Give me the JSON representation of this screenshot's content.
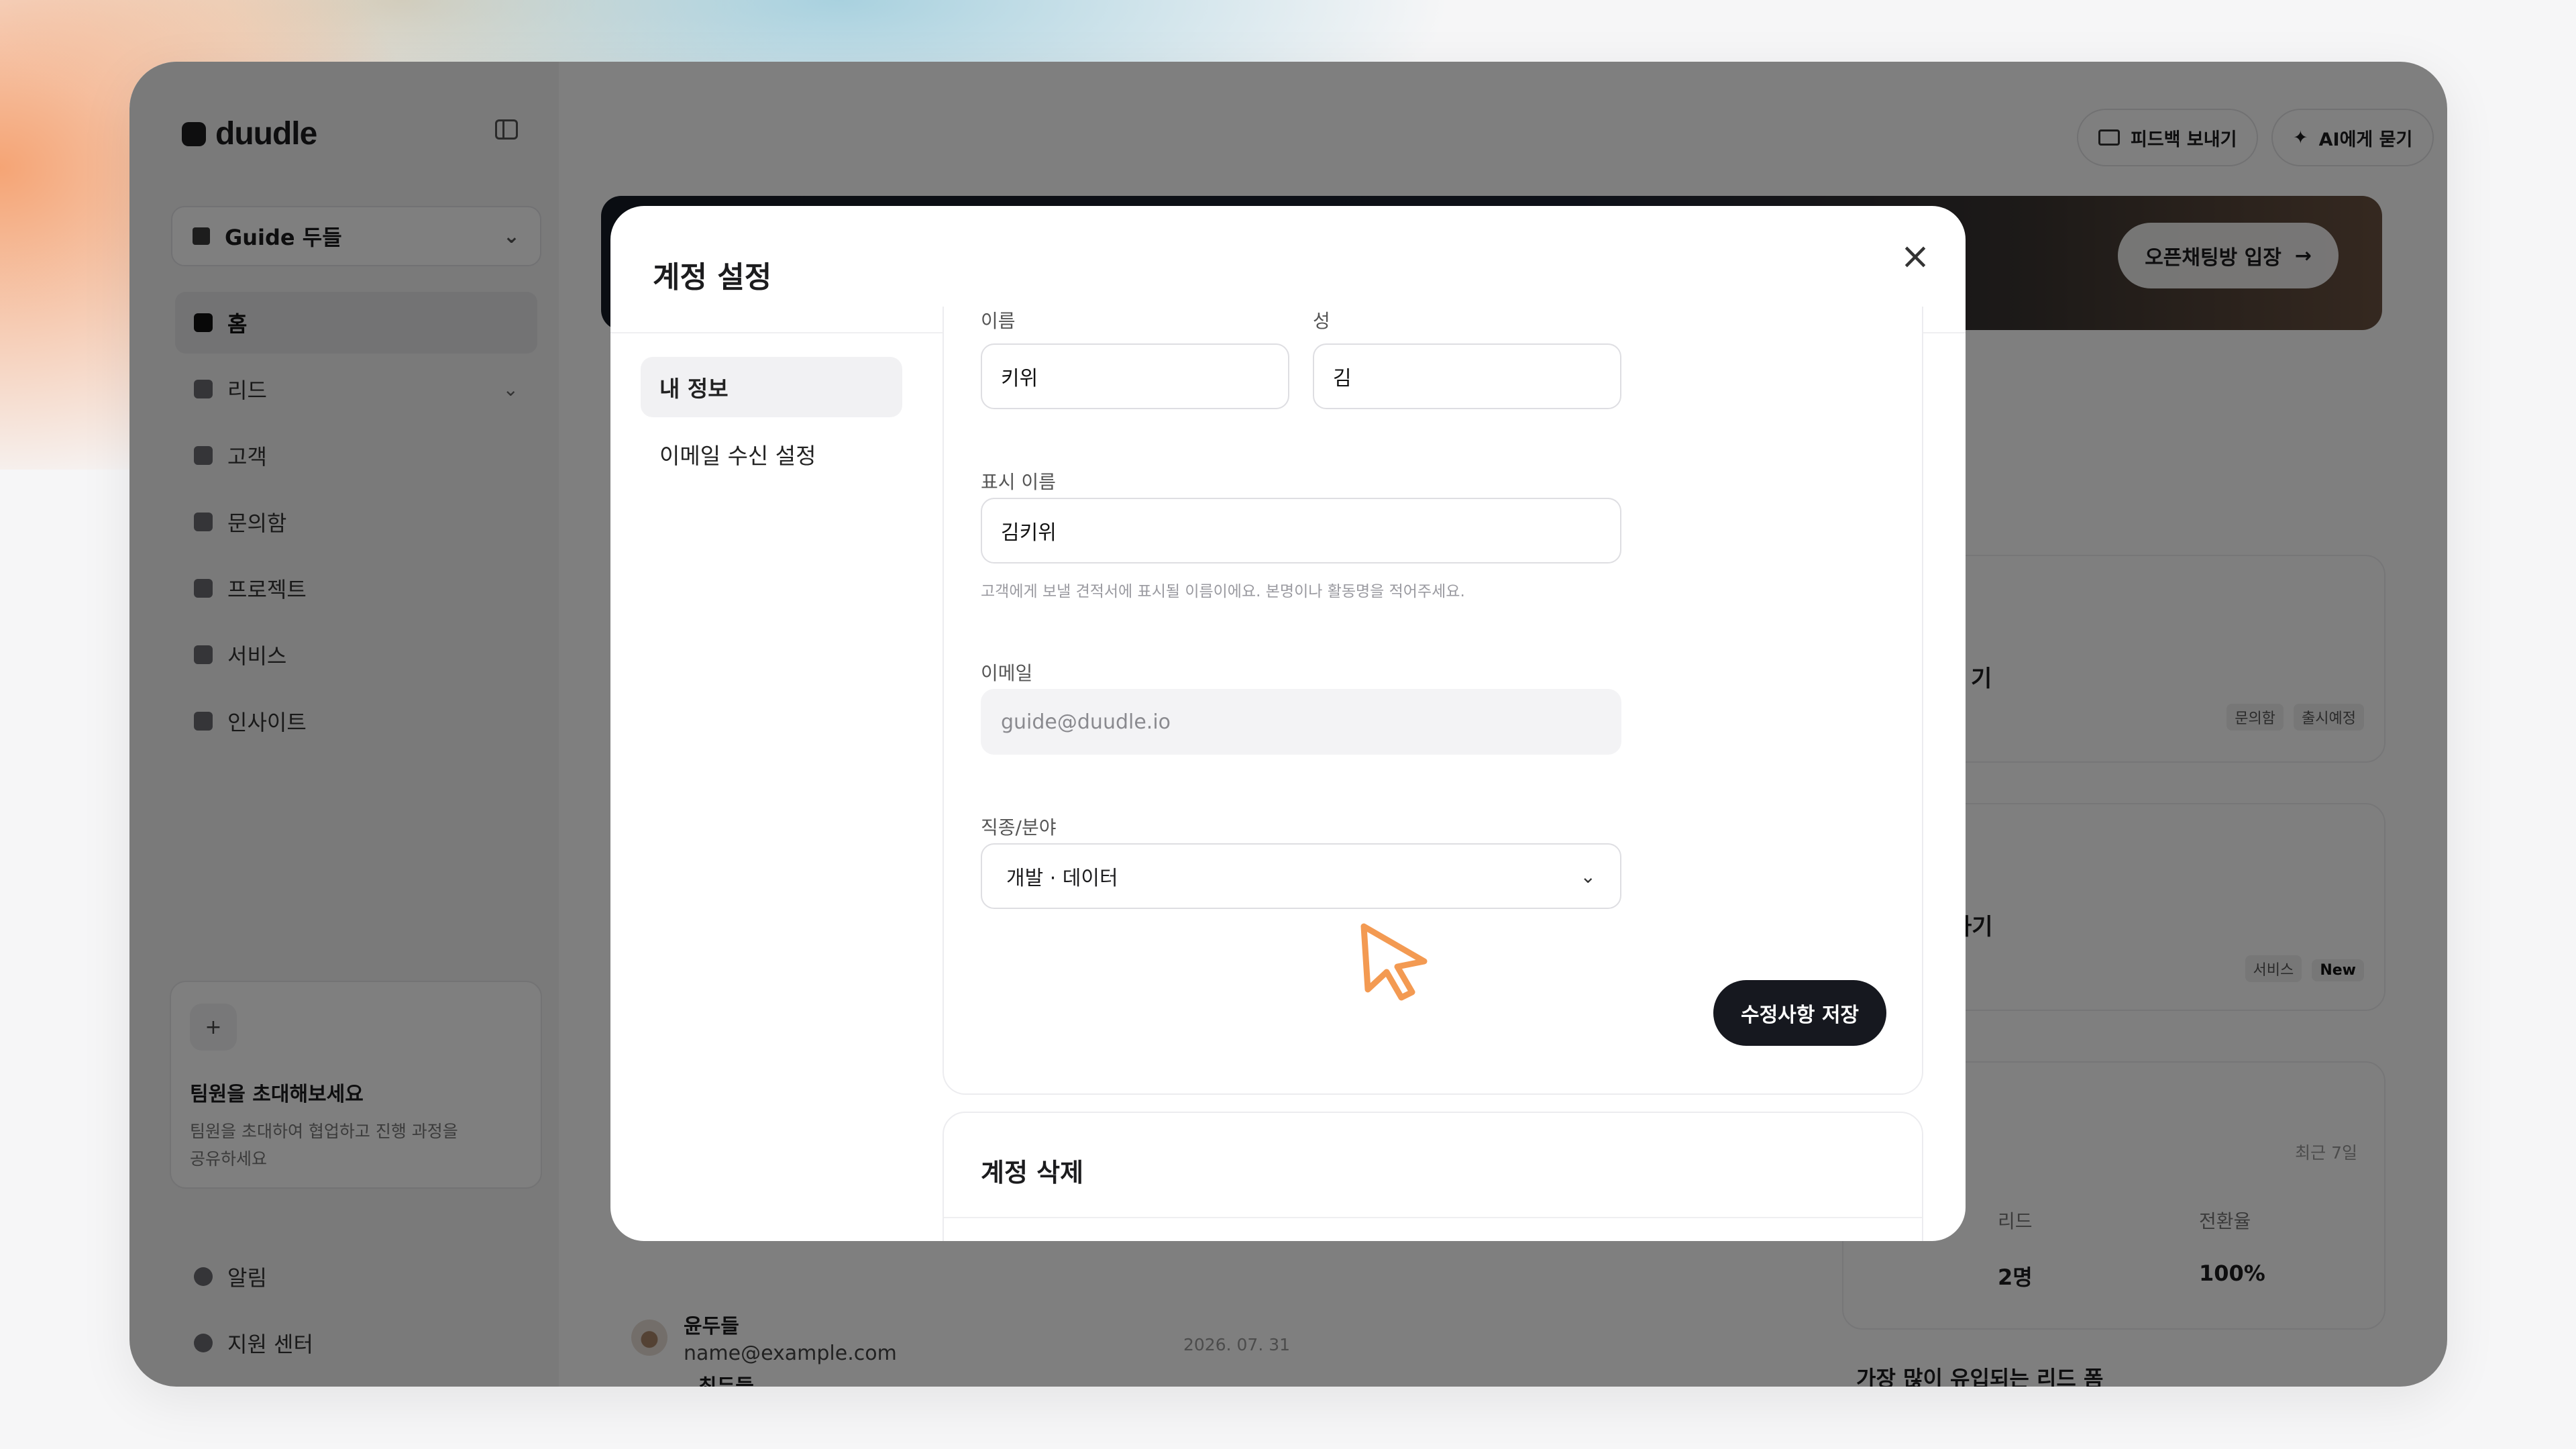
{
  "brand": {
    "name": "duudle"
  },
  "sidebar": {
    "workspace": "Guide 두들",
    "items": [
      {
        "label": "홈",
        "icon": "home-icon"
      },
      {
        "label": "리드",
        "icon": "lead-icon"
      },
      {
        "label": "고객",
        "icon": "person-icon"
      },
      {
        "label": "문의함",
        "icon": "inbox-icon"
      },
      {
        "label": "프로젝트",
        "icon": "folder-icon"
      },
      {
        "label": "서비스",
        "icon": "briefcase-icon"
      },
      {
        "label": "인사이트",
        "icon": "chart-icon"
      }
    ],
    "invite": {
      "title": "팀원을 초대해보세요",
      "description": "팀원을 초대하여 협업하고 진행 과정을 공유하세요"
    },
    "bottom": [
      {
        "label": "알림",
        "icon": "bell-icon"
      },
      {
        "label": "지원 센터",
        "icon": "help-icon"
      }
    ]
  },
  "header": {
    "feedback": "피드백 보내기",
    "ask_ai": "AI에게 묻기"
  },
  "banner": {
    "cta": "오픈채팅방 입장"
  },
  "background": {
    "card1_title_fragment": "기",
    "card1_tags": [
      "문의함",
      "출시예정"
    ],
    "card2_title_fragment": "하기",
    "card2_tags": [
      "서비스",
      "New"
    ],
    "recent_range": "최근 7일",
    "stats": [
      {
        "label": "리드",
        "value": "2명"
      },
      {
        "label": "전환율",
        "value": "100%"
      }
    ],
    "forms_title": "가장 많이 유입되는 리드 폼",
    "lead": {
      "name": "윤두들",
      "email": "name@example.com",
      "date": "2026. 07. 31"
    },
    "lead_next": "최두들"
  },
  "modal": {
    "title": "계정 설정",
    "nav": [
      {
        "label": "내 정보",
        "active": true
      },
      {
        "label": "이메일 수신 설정",
        "active": false
      }
    ],
    "form": {
      "first_name_label": "이름",
      "first_name": "키위",
      "last_name_label": "성",
      "last_name": "김",
      "display_name_label": "표시 이름",
      "display_name": "김키위",
      "display_name_hint": "고객에게 보낼 견적서에 표시될 이름이에요. 본명이나 활동명을 적어주세요.",
      "email_label": "이메일",
      "email": "guide@duudle.io",
      "job_label": "직종/분야",
      "job_value": "개발 · 데이터",
      "save": "수정사항 저장"
    },
    "delete": {
      "title": "계정 삭제"
    }
  },
  "colors": {
    "primary_button": "#16181f",
    "banner_dark": "#151a24",
    "cursor_orange": "#f39a52"
  }
}
